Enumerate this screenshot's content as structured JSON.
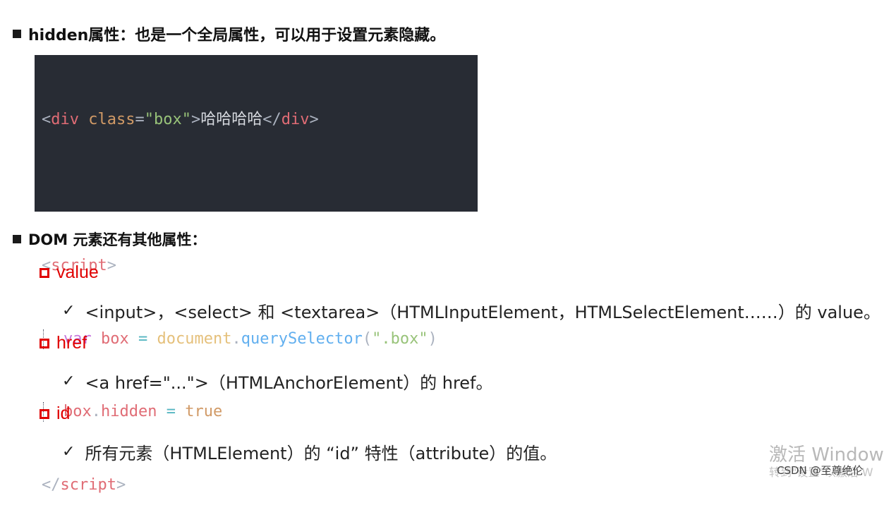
{
  "heading1": "hidden属性：也是一个全局属性，可以用于设置元素隐藏。",
  "code": {
    "line1": {
      "open": "<",
      "tag": "div",
      "attr": "class",
      "eq": "=",
      "val": "\"box\"",
      "close": ">",
      "text": "哈哈哈哈",
      "end_open": "</",
      "end_tag": "div",
      "end_close": ">"
    },
    "line3": {
      "open": "<",
      "tag": "script",
      "close": ">"
    },
    "line4": {
      "kw": "var",
      "name": "box",
      "op": "=",
      "obj": "document",
      "dot": ".",
      "fn": "querySelector",
      "paren_open": "(",
      "str": "\".box\"",
      "paren_close": ")"
    },
    "line5": {
      "name": "box",
      "dot": ".",
      "prop": "hidden",
      "op": "=",
      "bool": "true"
    },
    "line6": {
      "open": "</",
      "tag": "script",
      "close": ">"
    }
  },
  "heading2": "DOM 元素还有其他属性：",
  "properties": [
    {
      "name": "value",
      "desc": "<input>，<select> 和 <textarea>（HTMLInputElement，HTMLSelectElement……）的 value。"
    },
    {
      "name": "href",
      "desc": "<a href=\"...\">（HTMLAnchorElement）的 href。"
    },
    {
      "name": "id",
      "desc": "所有元素（HTMLElement）的 “id” 特性（attribute）的值。"
    }
  ],
  "check_glyph": "✓",
  "watermark": {
    "main": "激活 Windows",
    "sub": "转到\"设置\"以激活 W",
    "csdn": "CSDN @至尊绝伦"
  }
}
